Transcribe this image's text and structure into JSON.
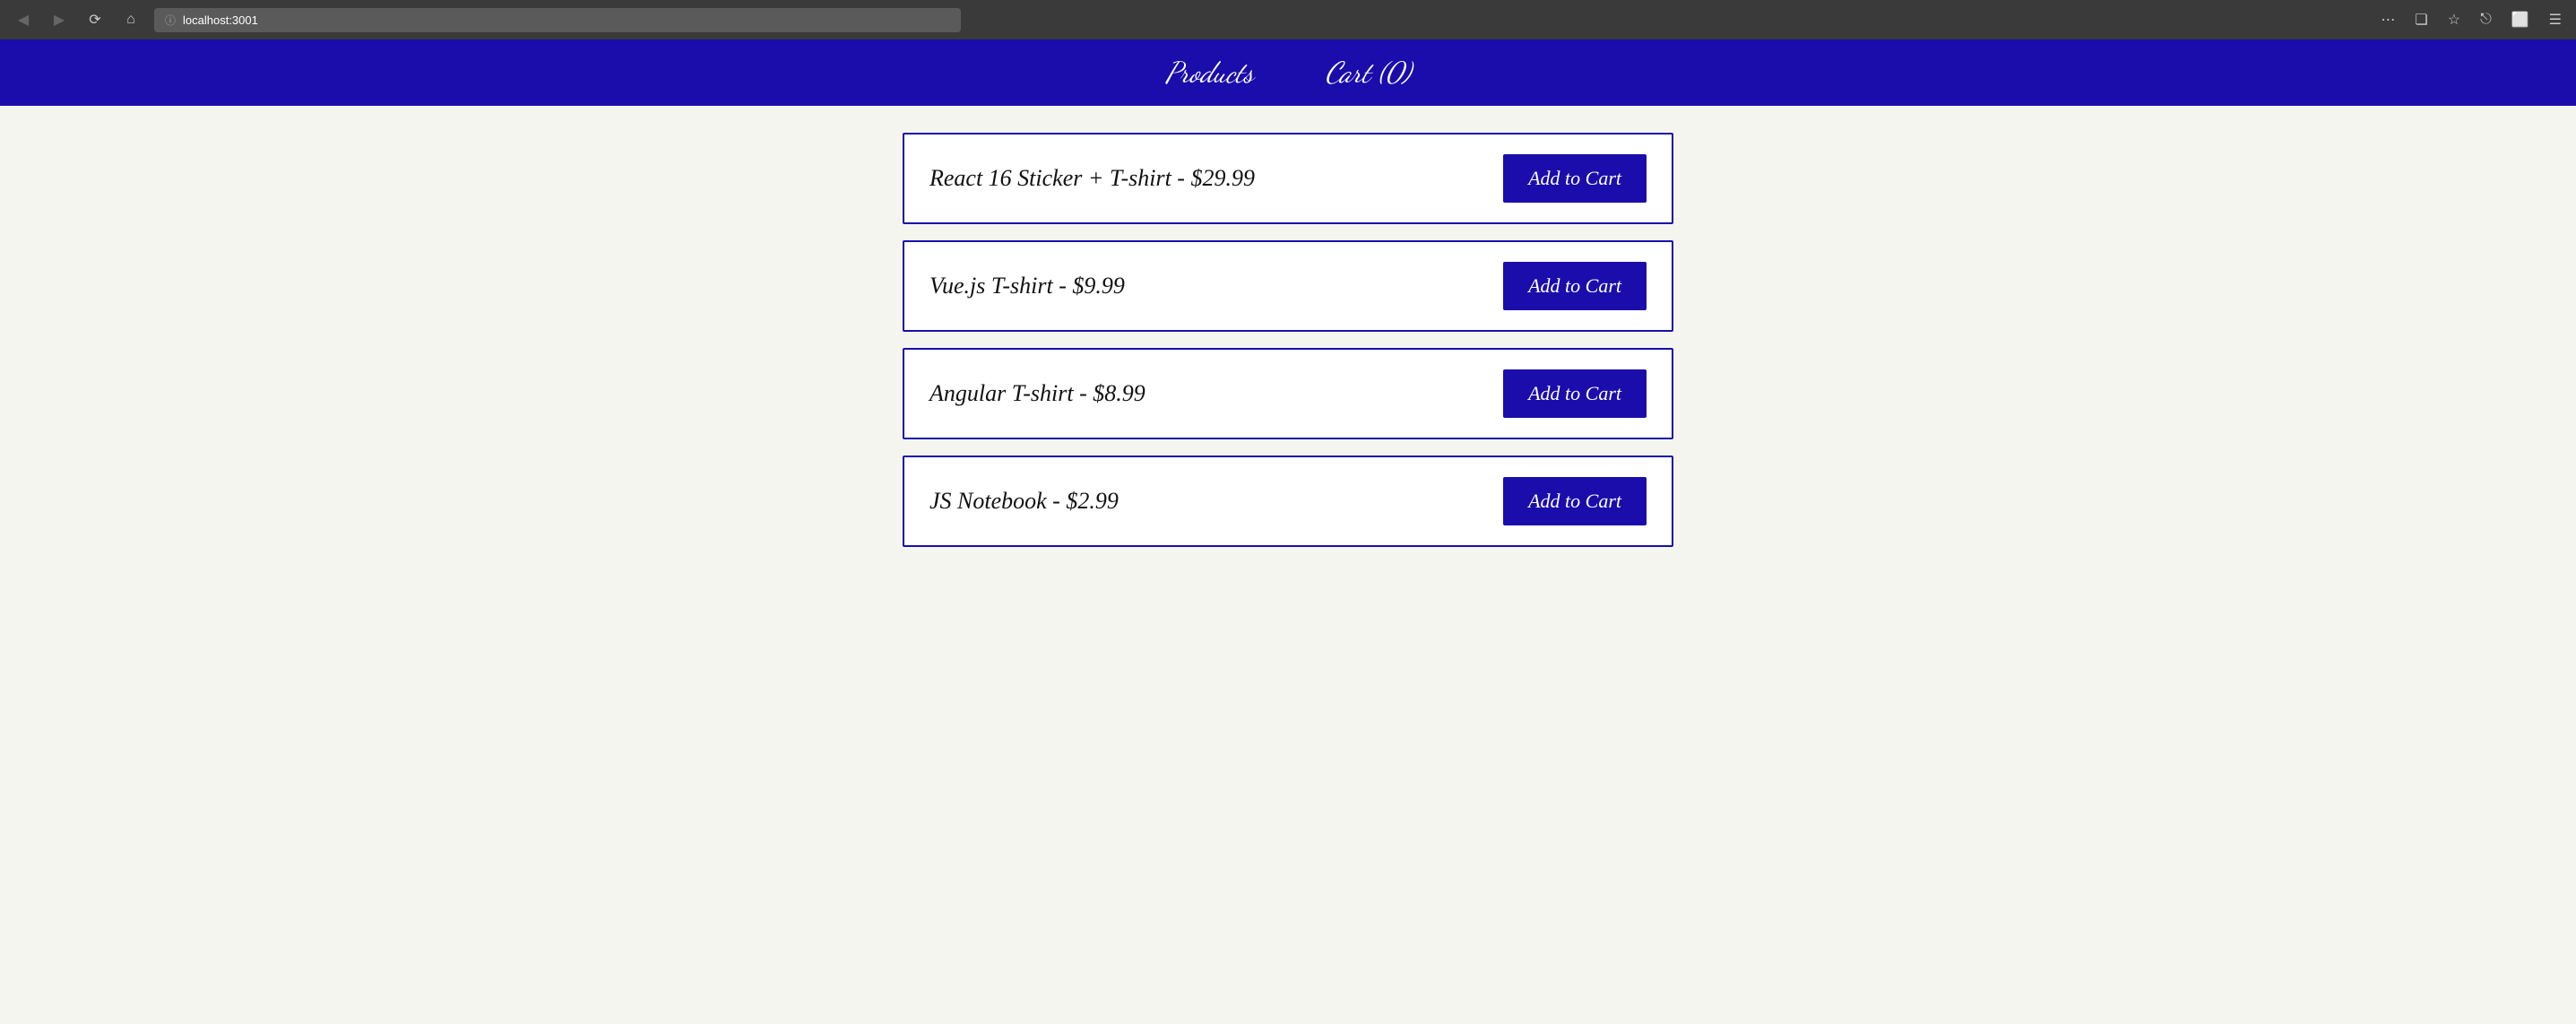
{
  "browser": {
    "url": "localhost:3001",
    "back_label": "◀",
    "forward_label": "▶",
    "reload_label": "↻",
    "home_label": "⌂",
    "more_label": "···",
    "pocket_label": "⛉",
    "star_label": "☆",
    "library_label": "|||",
    "sidebar_label": "▣",
    "menu_label": "≡"
  },
  "nav": {
    "products_label": "Products",
    "cart_label": "Cart (0)"
  },
  "products": [
    {
      "id": 1,
      "name": "React 16 Sticker + T-shirt - $29.99",
      "add_label": "Add to Cart"
    },
    {
      "id": 2,
      "name": "Vue.js T-shirt - $9.99",
      "add_label": "Add to Cart"
    },
    {
      "id": 3,
      "name": "Angular T-shirt - $8.99",
      "add_label": "Add to Cart"
    },
    {
      "id": 4,
      "name": "JS Notebook - $2.99",
      "add_label": "Add to Cart"
    }
  ]
}
